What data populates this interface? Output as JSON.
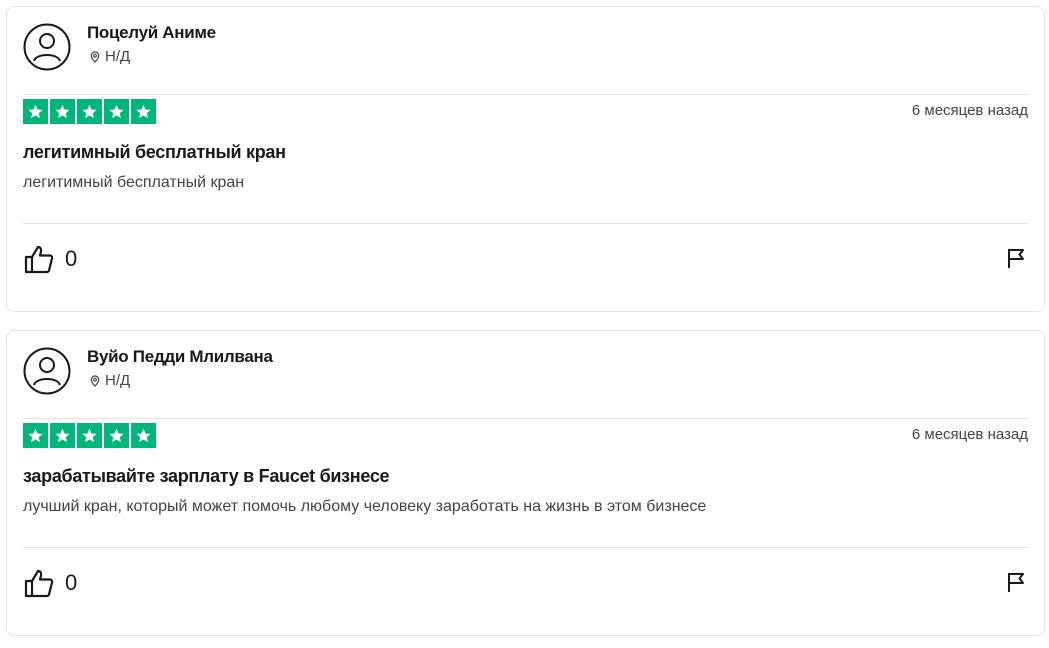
{
  "reviews": [
    {
      "reviewer_name": "Поцелуй Аниме",
      "location": "Н/Д",
      "rating": 5,
      "date": "6 месяцев назад",
      "title": "легитимный бесплатный кран",
      "text": "легитимный бесплатный кран",
      "likes": "0"
    },
    {
      "reviewer_name": "Вуйо Педди Млилвана",
      "location": "Н/Д",
      "rating": 5,
      "date": "6 месяцев назад",
      "title": "зарабатывайте зарплату в Faucet бизнесе",
      "text": "лучший кран, который может помочь любому человеку заработать на жизнь в этом бизнесе",
      "likes": "0"
    }
  ],
  "colors": {
    "star_green": "#00b67a",
    "border": "#e5e5dd",
    "text_primary": "#191919",
    "text_secondary": "#444444"
  },
  "icons": {
    "avatar": "user-circle-icon",
    "location": "location-pin-icon",
    "star": "star-icon",
    "like": "thumbs-up-icon",
    "report": "flag-icon"
  }
}
